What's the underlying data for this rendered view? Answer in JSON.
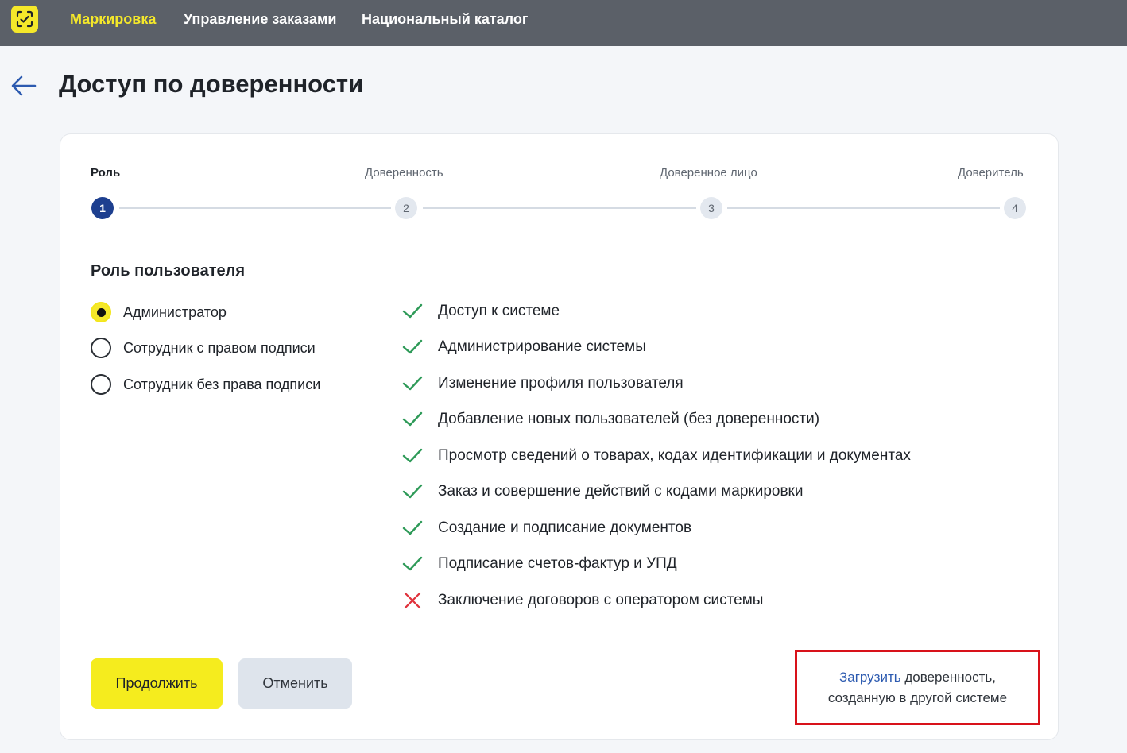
{
  "nav": {
    "items": [
      {
        "label": "Маркировка",
        "active": true
      },
      {
        "label": "Управление заказами",
        "active": false
      },
      {
        "label": "Национальный каталог",
        "active": false
      }
    ]
  },
  "page": {
    "title": "Доступ по доверенности"
  },
  "stepper": {
    "steps": [
      {
        "label": "Роль",
        "number": "1",
        "active": true
      },
      {
        "label": "Доверенность",
        "number": "2",
        "active": false
      },
      {
        "label": "Доверенное лицо",
        "number": "3",
        "active": false
      },
      {
        "label": "Доверитель",
        "number": "4",
        "active": false
      }
    ]
  },
  "role_section": {
    "title": "Роль пользователя",
    "options": [
      {
        "label": "Администратор",
        "checked": true
      },
      {
        "label": "Сотрудник с правом подписи",
        "checked": false
      },
      {
        "label": "Сотрудник без права подписи",
        "checked": false
      }
    ]
  },
  "permissions": [
    {
      "label": "Доступ к системе",
      "allowed": true
    },
    {
      "label": "Администрирование системы",
      "allowed": true
    },
    {
      "label": "Изменение профиля пользователя",
      "allowed": true
    },
    {
      "label": "Добавление новых пользователей (без доверенности)",
      "allowed": true
    },
    {
      "label": "Просмотр сведений о товарах, кодах идентификации и документах",
      "allowed": true
    },
    {
      "label": "Заказ и совершение действий с кодами маркировки",
      "allowed": true
    },
    {
      "label": "Создание и подписание документов",
      "allowed": true
    },
    {
      "label": "Подписание счетов-фактур и УПД",
      "allowed": true
    },
    {
      "label": "Заключение договоров с оператором системы",
      "allowed": false
    }
  ],
  "actions": {
    "continue_label": "Продолжить",
    "cancel_label": "Отменить"
  },
  "upload": {
    "link_text": "Загрузить",
    "text_rest_line1": " доверенность,",
    "text_line2": "созданную в другой системе"
  },
  "colors": {
    "topbar": "#5b6068",
    "brand_yellow": "#f5e82a",
    "step_active": "#1d3f8f",
    "check_green": "#2e9a58",
    "cross_red": "#e0313b",
    "highlight_red": "#d8121a"
  }
}
